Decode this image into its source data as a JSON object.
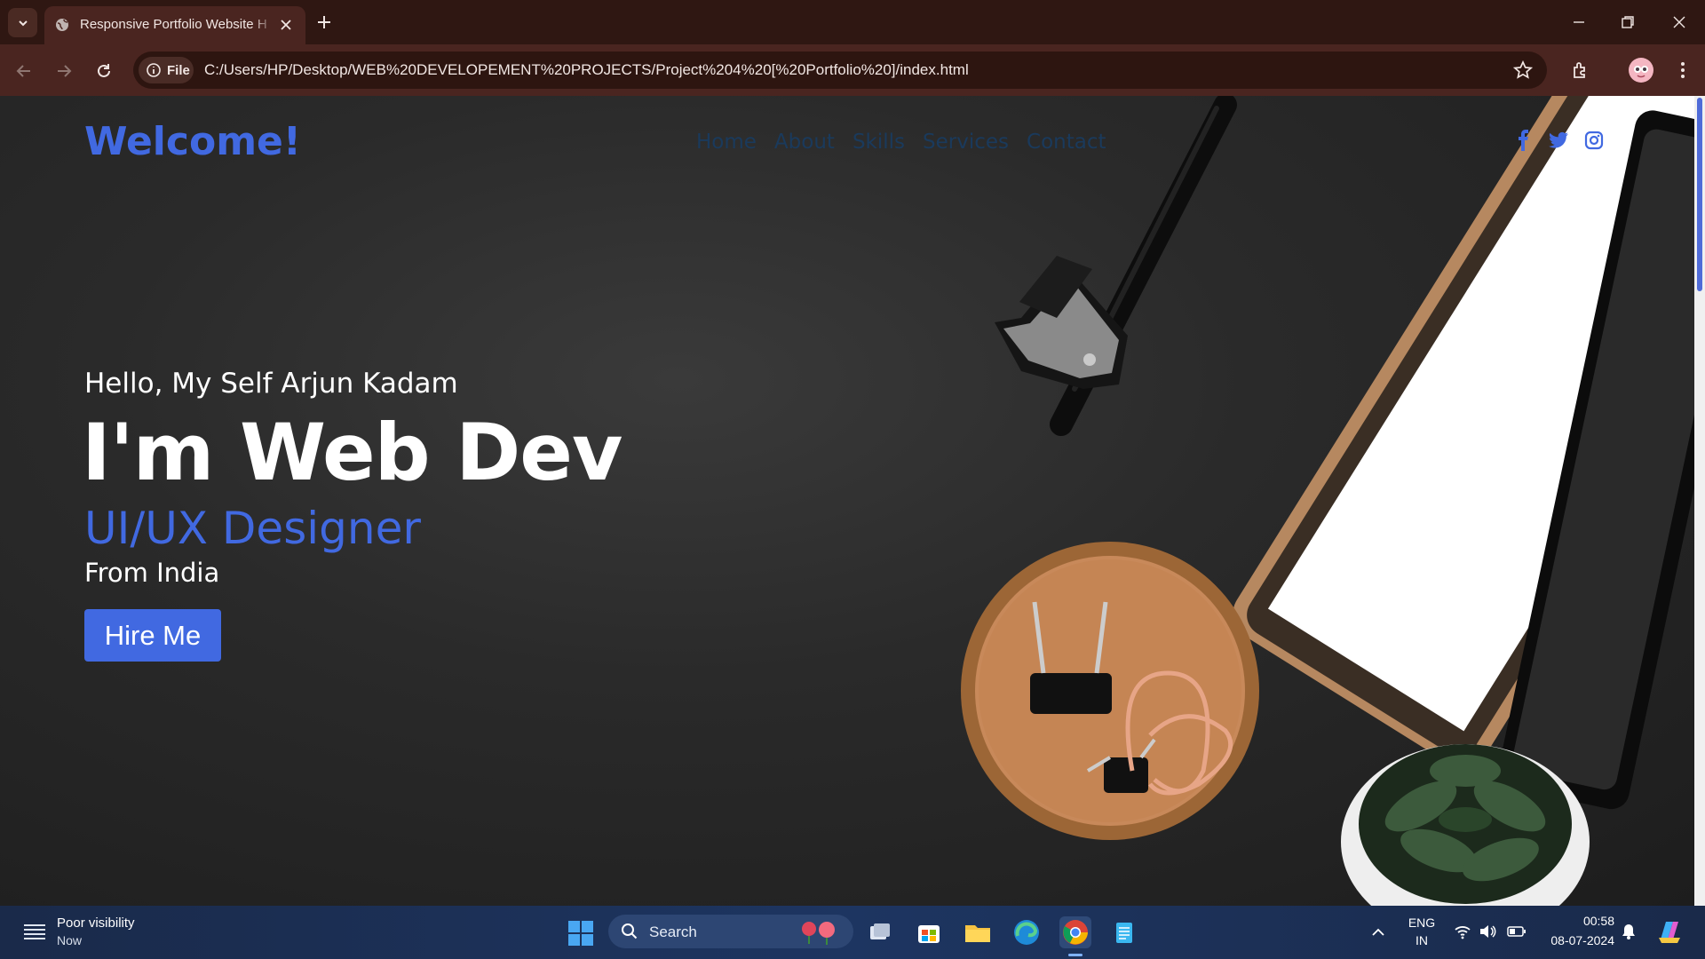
{
  "browser": {
    "tab_title": "Responsive Portfolio Website H",
    "new_tab_symbol": "+",
    "address_chip": "File",
    "url": "C:/Users/HP/Desktop/WEB%20DEVELOPEMENT%20PROJECTS/Project%204%20[%20Portfolio%20]/index.html",
    "theme_color": "#2f1712"
  },
  "site": {
    "logo": "Welcome!",
    "nav": [
      "Home",
      "About",
      "Skills",
      "Services",
      "Contact"
    ],
    "social": [
      "facebook-icon",
      "twitter-icon",
      "instagram-icon"
    ],
    "hero": {
      "greeting": "Hello, My Self Arjun Kadam",
      "headline": "I'm Web Dev",
      "role": "UI/UX Designer",
      "location": "From India",
      "cta": "Hire Me"
    },
    "accent_color": "#4169e1"
  },
  "taskbar": {
    "weather_title": "Poor visibility",
    "weather_sub": "Now",
    "search_label": "Search",
    "language_top": "ENG",
    "language_bottom": "IN",
    "time": "00:58",
    "date": "08-07-2024"
  }
}
